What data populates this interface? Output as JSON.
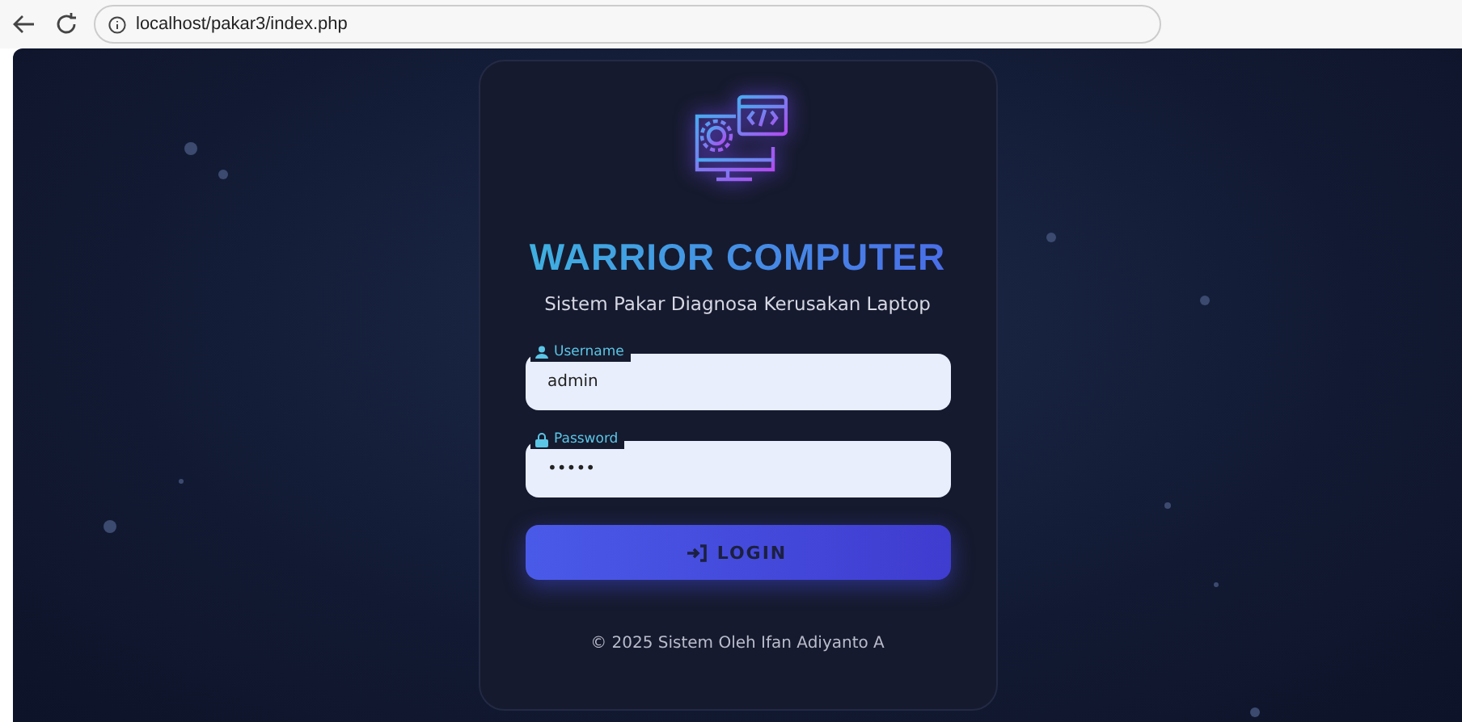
{
  "browser": {
    "url": "localhost/pakar3/index.php"
  },
  "login": {
    "title": "WARRIOR COMPUTER",
    "subtitle": "Sistem Pakar Diagnosa Kerusakan Laptop",
    "fields": [
      {
        "kind": "user",
        "label": "Username",
        "value": "admin"
      },
      {
        "kind": "lock",
        "label": "Password",
        "value": "•••••"
      }
    ],
    "button": "LOGIN",
    "footer": "© 2025 Sistem Oleh Ifan Adiyanto A"
  }
}
